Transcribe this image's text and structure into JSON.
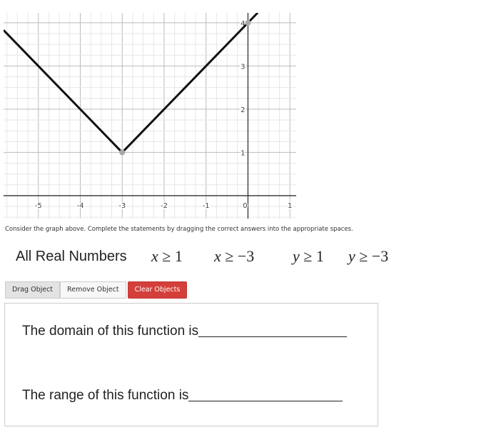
{
  "chart_data": {
    "type": "line",
    "xlim": [
      -5.83,
      1.15
    ],
    "ylim": [
      -0.53,
      4.23
    ],
    "x_ticks": [
      "-5",
      "-4",
      "-3",
      "-2",
      "-1",
      "0",
      "1"
    ],
    "y_ticks": [
      "1",
      "2",
      "3",
      "4"
    ],
    "grid": true,
    "series": [
      {
        "x": [
          -5.83,
          -3,
          0.23
        ],
        "y": [
          3.83,
          1,
          4.23
        ]
      }
    ],
    "points": [
      {
        "x": -3,
        "y": 1
      },
      {
        "x": 0,
        "y": 4
      }
    ]
  },
  "instructions": "Consider the graph above. Complete the statements by dragging the correct answers into the appropriate spaces.",
  "choices": {
    "all_real": "All Real Numbers",
    "x_ge_1": {
      "var": "x",
      "rel": "≥ 1"
    },
    "x_ge_m3": {
      "var": "x",
      "rel": "≥ −3"
    },
    "y_ge_1": {
      "var": "y",
      "rel": "≥ 1"
    },
    "y_ge_m3": {
      "var": "y",
      "rel": "≥ −3"
    }
  },
  "toolbar": {
    "drag": "Drag Object",
    "remove": "Remove Object",
    "clear": "Clear Objects",
    "clear_color": "#d43f3a"
  },
  "statements": {
    "domain": "The domain of this function is",
    "range": "The range of this function is "
  }
}
